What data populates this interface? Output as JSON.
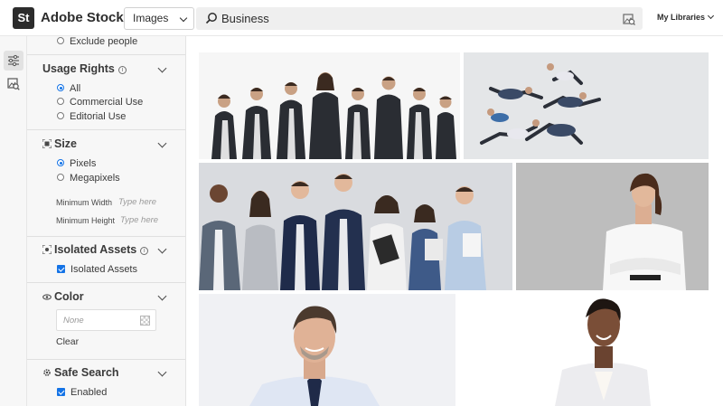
{
  "header": {
    "logo_text": "St",
    "brand": "Adobe Stock",
    "asset_type": "Images",
    "search_query": "Business",
    "my_libraries": "My Libraries"
  },
  "rail": {
    "items": [
      {
        "icon": "filters-icon",
        "active": true
      },
      {
        "icon": "visual-search-icon",
        "active": false
      }
    ]
  },
  "filters": {
    "exclude_people": "Exclude people",
    "usage_rights": {
      "title": "Usage Rights",
      "options": [
        {
          "label": "All",
          "selected": true
        },
        {
          "label": "Commercial Use",
          "selected": false
        },
        {
          "label": "Editorial Use",
          "selected": false
        }
      ]
    },
    "size": {
      "title": "Size",
      "options": [
        {
          "label": "Pixels",
          "selected": true
        },
        {
          "label": "Megapixels",
          "selected": false
        }
      ],
      "min_width_label": "Minimum Width",
      "min_width_placeholder": "Type here",
      "min_height_label": "Minimum Height",
      "min_height_placeholder": "Type here"
    },
    "isolated_assets": {
      "title": "Isolated Assets",
      "checkbox_label": "Isolated Assets",
      "checked": true
    },
    "color": {
      "title": "Color",
      "value": "None",
      "clear": "Clear"
    },
    "safe_search": {
      "title": "Safe Search",
      "checkbox_label": "Enabled",
      "checked": true
    }
  },
  "results": {
    "images": [
      {
        "subject": "business team group in suits"
      },
      {
        "subject": "business people jumping"
      },
      {
        "subject": "diverse office team smiling"
      },
      {
        "subject": "businesswoman arms crossed"
      },
      {
        "subject": "smiling businessman portrait"
      },
      {
        "subject": "smiling businesswoman portrait"
      }
    ]
  },
  "colors": {
    "accent": "#1473e6",
    "panel_bg": "#f7f7f7",
    "header_bg": "#ffffff"
  }
}
